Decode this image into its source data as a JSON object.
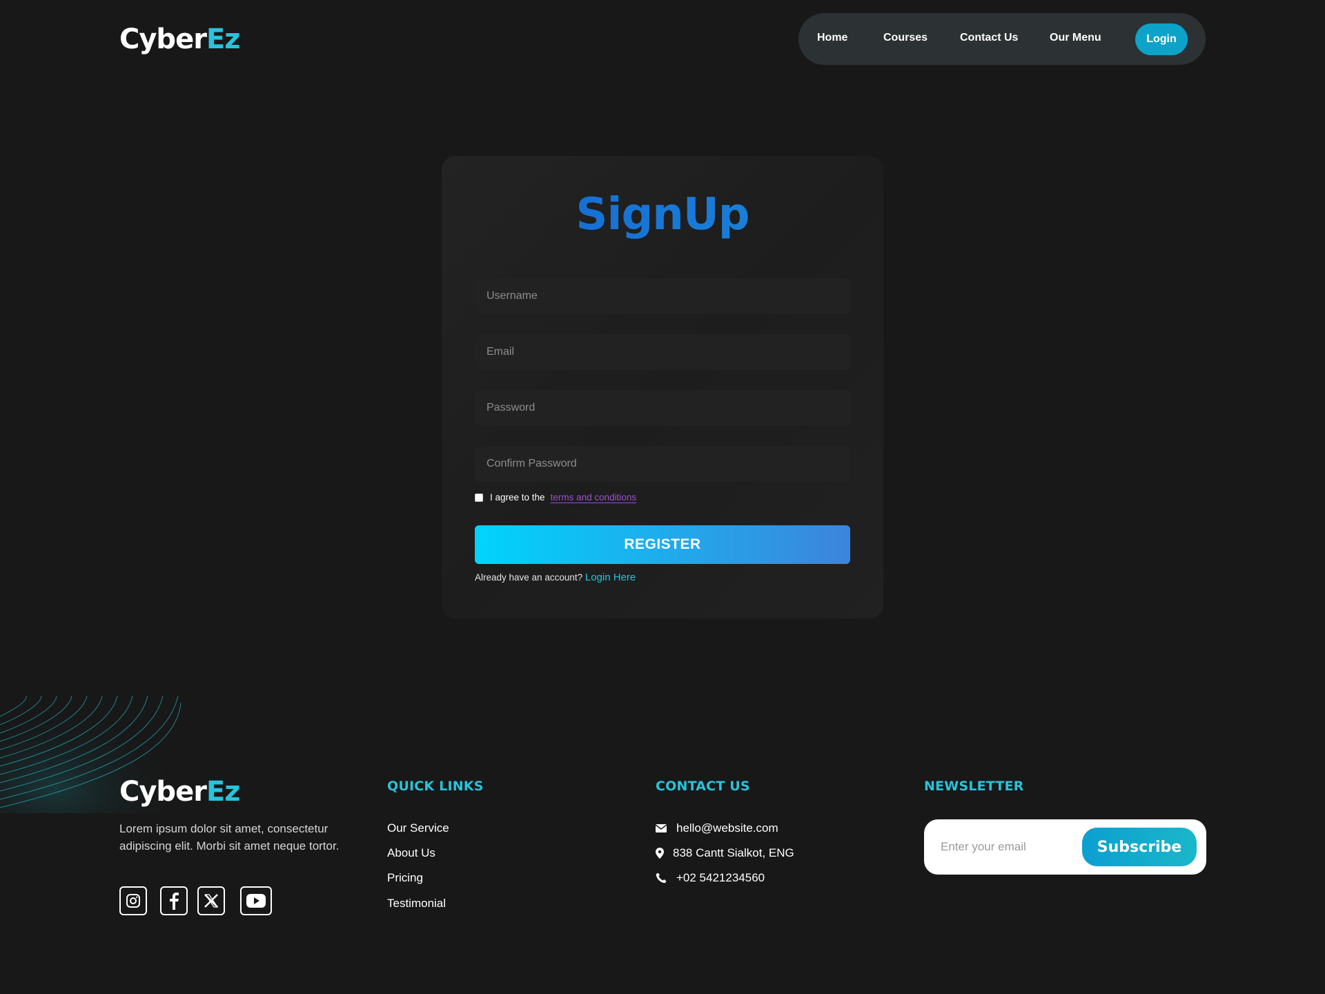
{
  "brand": {
    "name_part1": "Cyber",
    "name_part2": "Ez",
    "accent_color": "#29c3db"
  },
  "nav": {
    "items": [
      "Home",
      "Courses",
      "Contact Us",
      "Our Menu"
    ],
    "login_label": "Login"
  },
  "signup": {
    "title": "SignUp",
    "username_placeholder": "Username",
    "email_placeholder": "Email",
    "password_placeholder": "Password",
    "confirm_placeholder": "Confirm Password",
    "terms_prefix": "I agree to the",
    "terms_link": "terms and conditions",
    "register_label": "REGISTER",
    "login_prompt": "Already have an account?",
    "login_link": "Login Here"
  },
  "footer": {
    "description": "Lorem ipsum dolor sit amet, consectetur adipiscing elit. Morbi sit amet neque tortor.",
    "social_icons": [
      "instagram-icon",
      "facebook-icon",
      "x-icon",
      "youtube-icon"
    ],
    "quick_links_title": "QUICK LINKS",
    "quick_links": [
      "Our Service",
      "About Us",
      "Pricing",
      "Testimonial"
    ],
    "contact_title": "CONTACT US",
    "contact": {
      "email": "hello@website.com",
      "address": "838 Cantt Sialkot, ENG",
      "phone": "+02 5421234560"
    },
    "newsletter_title": "NEWSLETTER",
    "newsletter_placeholder": "Enter your email",
    "subscribe_label": "Subscribe"
  }
}
